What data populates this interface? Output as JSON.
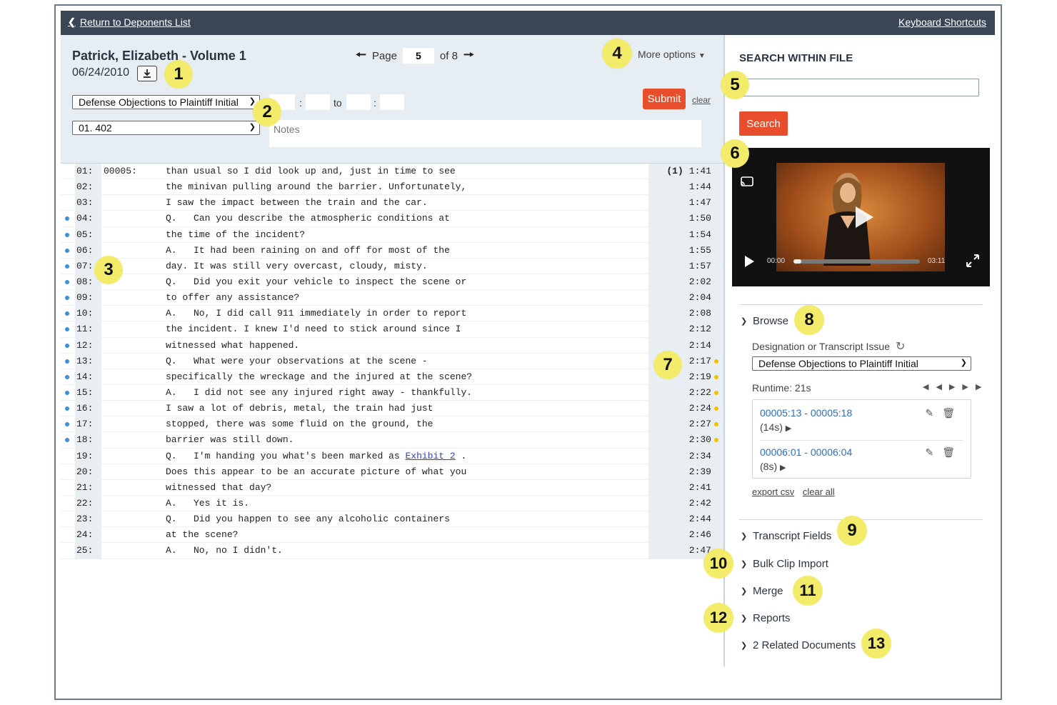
{
  "topbar": {
    "back_label": "Return to Deponents List",
    "shortcuts_label": "Keyboard Shortcuts"
  },
  "header": {
    "title": "Patrick, Elizabeth - Volume 1",
    "date": "06/24/2010",
    "pager": {
      "page_label": "Page",
      "page": "5",
      "of_label": "of 8"
    },
    "more_options": "More options",
    "designation_select": "Defense Objections to Plaintiff Initial",
    "issue_select": "01. 402",
    "range_sep": ":",
    "to_label": "to",
    "submit": "Submit",
    "clear": "clear",
    "notes_placeholder": "Notes"
  },
  "transcript": {
    "page_ref": "00005:",
    "lines": [
      {
        "num": "01:",
        "text": "than usual so I did look up and, just in time to see",
        "tc": "1:41",
        "vol": "(1)",
        "blue": false,
        "yellow": false
      },
      {
        "num": "02:",
        "text": "the minivan pulling around the barrier. Unfortunately,",
        "tc": "1:44",
        "blue": false,
        "yellow": false
      },
      {
        "num": "03:",
        "text": "I saw the impact between the train and the car.",
        "tc": "1:47",
        "blue": false,
        "yellow": false
      },
      {
        "num": "04:",
        "text": "Q.   Can you describe the atmospheric conditions at",
        "tc": "1:50",
        "blue": true,
        "yellow": false
      },
      {
        "num": "05:",
        "text": "the time of the incident?",
        "tc": "1:54",
        "blue": true,
        "yellow": false
      },
      {
        "num": "06:",
        "text": "A.   It had been raining on and off for most of the",
        "tc": "1:55",
        "blue": true,
        "yellow": false
      },
      {
        "num": "07:",
        "text": "day. It was still very overcast, cloudy, misty.",
        "tc": "1:57",
        "blue": true,
        "yellow": false
      },
      {
        "num": "08:",
        "text": "Q.   Did you exit your vehicle to inspect the scene or",
        "tc": "2:02",
        "blue": true,
        "yellow": false
      },
      {
        "num": "09:",
        "text": "to offer any assistance?",
        "tc": "2:04",
        "blue": true,
        "yellow": false
      },
      {
        "num": "10:",
        "text": "A.   No, I did call 911 immediately in order to report",
        "tc": "2:08",
        "blue": true,
        "yellow": false
      },
      {
        "num": "11:",
        "text": "the incident. I knew I'd need to stick around since I",
        "tc": "2:12",
        "blue": true,
        "yellow": false
      },
      {
        "num": "12:",
        "text": "witnessed what happened.",
        "tc": "2:14",
        "blue": true,
        "yellow": false
      },
      {
        "num": "13:",
        "text": "Q.   What were your observations at the scene -",
        "tc": "2:17",
        "blue": true,
        "yellow": true
      },
      {
        "num": "14:",
        "text": "specifically the wreckage and the injured at the scene?",
        "tc": "2:19",
        "blue": true,
        "yellow": true
      },
      {
        "num": "15:",
        "text": "A.   I did not see any injured right away - thankfully.",
        "tc": "2:22",
        "blue": true,
        "yellow": true
      },
      {
        "num": "16:",
        "text": "I saw a lot of debris, metal, the train had just",
        "tc": "2:24",
        "blue": true,
        "yellow": true
      },
      {
        "num": "17:",
        "text": "stopped, there was some fluid on the ground, the",
        "tc": "2:27",
        "blue": true,
        "yellow": true
      },
      {
        "num": "18:",
        "text": "barrier was still down.",
        "tc": "2:30",
        "blue": true,
        "yellow": true
      },
      {
        "num": "19:",
        "text": "Q.   I'm handing you what's been marked as ",
        "link": "Exhibit 2",
        "after": " .",
        "tc": "2:34",
        "blue": false,
        "yellow": false
      },
      {
        "num": "20:",
        "text": "Does this appear to be an accurate picture of what you",
        "tc": "2:39",
        "blue": false,
        "yellow": false
      },
      {
        "num": "21:",
        "text": "witnessed that day?",
        "tc": "2:41",
        "blue": false,
        "yellow": false
      },
      {
        "num": "22:",
        "text": "A.   Yes it is.",
        "tc": "2:42",
        "blue": false,
        "yellow": false
      },
      {
        "num": "23:",
        "text": "Q.   Did you happen to see any alcoholic containers",
        "tc": "2:44",
        "blue": false,
        "yellow": false
      },
      {
        "num": "24:",
        "text": "at the scene?",
        "tc": "2:46",
        "blue": false,
        "yellow": false
      },
      {
        "num": "25:",
        "text": "A.   No, no I didn't.",
        "tc": "2:47",
        "blue": false,
        "yellow": false
      }
    ]
  },
  "sidebar": {
    "search_heading": "SEARCH WITHIN FILE",
    "search_button": "Search",
    "video": {
      "current": "00:00",
      "duration": "03:11",
      "progress": 0.06
    },
    "browse": {
      "label": "Browse",
      "field_label": "Designation or Transcript Issue",
      "select": "Defense Objections to Plaintiff Initial",
      "runtime": "Runtime: 21s",
      "clips": [
        {
          "range": "00005:13 - 00005:18",
          "dur": "(14s)"
        },
        {
          "range": "00006:01 - 00006:04",
          "dur": "(8s)"
        }
      ],
      "export_csv": "export csv",
      "clear_all": "clear all"
    },
    "sections": [
      "Transcript Fields",
      "Bulk Clip Import",
      "Merge",
      "Reports",
      "2 Related Documents"
    ]
  },
  "annotations": [
    "1",
    "2",
    "3",
    "4",
    "5",
    "6",
    "7",
    "8",
    "9",
    "10",
    "11",
    "12",
    "13"
  ],
  "colors": {
    "topbar": "#3a4656",
    "accent": "#e84e2b",
    "header_bg": "#e6edf3",
    "badge": "#f2ec6a",
    "blue_dot": "#3a8fd6",
    "yellow_dot": "#f2c200"
  }
}
